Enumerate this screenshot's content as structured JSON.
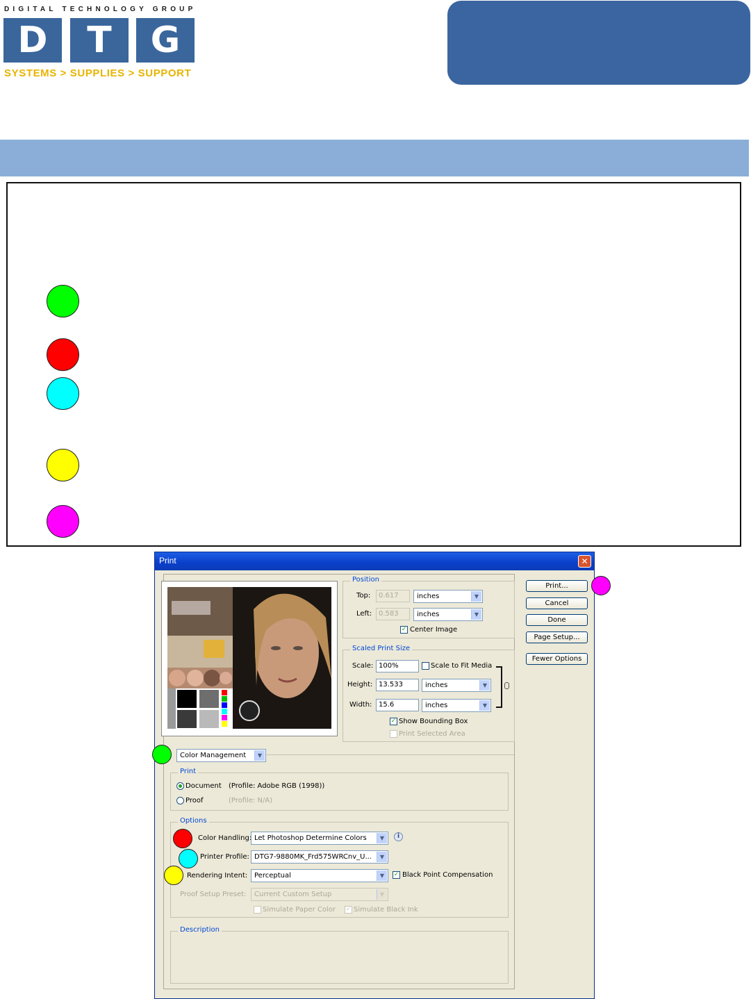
{
  "header": {
    "logo_tagline": "DIGITAL TECHNOLOGY GROUP",
    "logo_letters": [
      "D",
      "T",
      "G"
    ],
    "logo_subtitle": "SYSTEMS > SUPPLIES > SUPPORT",
    "colors": {
      "brand_blue": "#3a669c",
      "subtitle_gold": "#e8b400",
      "band": "#8aaed8"
    }
  },
  "legend": {
    "markers": [
      {
        "color": "#00ff00",
        "name": "green"
      },
      {
        "color": "#ff0000",
        "name": "red"
      },
      {
        "color": "#00ffff",
        "name": "cyan"
      },
      {
        "color": "#ffff00",
        "name": "yellow"
      },
      {
        "color": "#ff00ff",
        "name": "magenta"
      }
    ]
  },
  "dialog": {
    "title": "Print",
    "close_glyph": "✕",
    "position": {
      "label": "Position",
      "top_label": "Top:",
      "top_value": "0.617",
      "top_unit": "inches",
      "left_label": "Left:",
      "left_value": "0.583",
      "left_unit": "inches",
      "center_image": "Center Image"
    },
    "scaled": {
      "label": "Scaled Print Size",
      "scale_label": "Scale:",
      "scale_value": "100%",
      "scale_to_fit": "Scale to Fit Media",
      "height_label": "Height:",
      "height_value": "13.533",
      "height_unit": "inches",
      "width_label": "Width:",
      "width_value": "15.6",
      "width_unit": "inches",
      "show_bounding_box": "Show Bounding Box",
      "print_selected_area": "Print Selected Area"
    },
    "buttons": {
      "print": "Print...",
      "cancel": "Cancel",
      "done": "Done",
      "page_setup": "Page Setup...",
      "fewer_options": "Fewer Options"
    },
    "mode_select": "Color Management",
    "print_group": {
      "label": "Print",
      "document": "Document",
      "document_profile": "(Profile: Adobe RGB (1998))",
      "proof": "Proof",
      "proof_profile": "(Profile: N/A)"
    },
    "options": {
      "label": "Options",
      "color_handling_label": "Color Handling:",
      "color_handling_value": "Let Photoshop Determine Colors",
      "printer_profile_label": "Printer Profile:",
      "printer_profile_value": "DTG7-9880MK_Frd575WRCnv_U...",
      "rendering_intent_label": "Rendering Intent:",
      "rendering_intent_value": "Perceptual",
      "black_point": "Black Point Compensation",
      "proof_setup_label": "Proof Setup Preset:",
      "proof_setup_value": "Current Custom Setup",
      "simulate_paper": "Simulate Paper Color",
      "simulate_black": "Simulate Black Ink"
    },
    "description": {
      "label": "Description"
    }
  }
}
